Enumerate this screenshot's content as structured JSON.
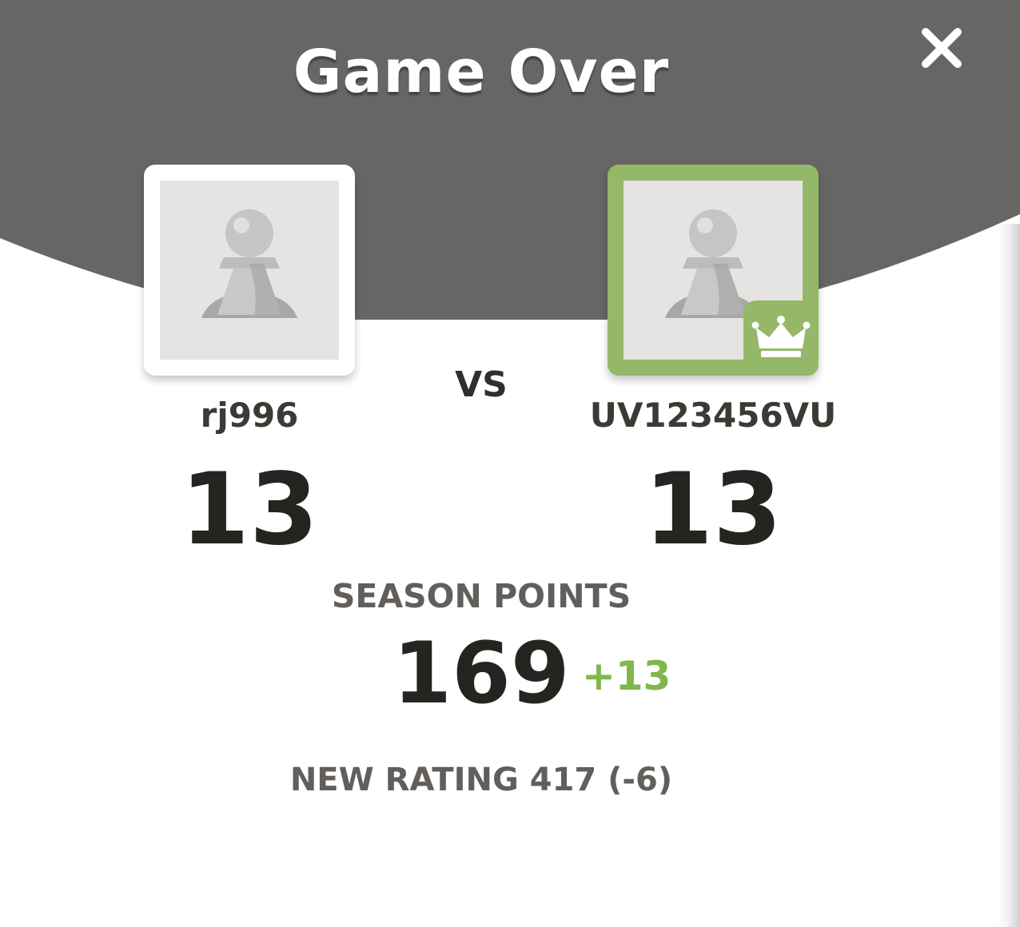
{
  "modal": {
    "title": "Game Over",
    "close_icon": "close-icon",
    "colors": {
      "header_bg": "#676665",
      "winner_border": "#95b868",
      "positive_delta": "#81b64c"
    }
  },
  "players": {
    "left": {
      "username": "rj996",
      "score": "13",
      "avatar_icon": "pawn-icon",
      "is_winner": false
    },
    "right": {
      "username": "UV123456VU",
      "score": "13",
      "avatar_icon": "pawn-icon",
      "is_winner": true,
      "badge_icon": "crown-icon"
    }
  },
  "versus_label": "VS",
  "season": {
    "label": "SEASON POINTS",
    "value": "169",
    "delta": "+13"
  },
  "rating": {
    "text": "NEW RATING 417 (-6)"
  }
}
